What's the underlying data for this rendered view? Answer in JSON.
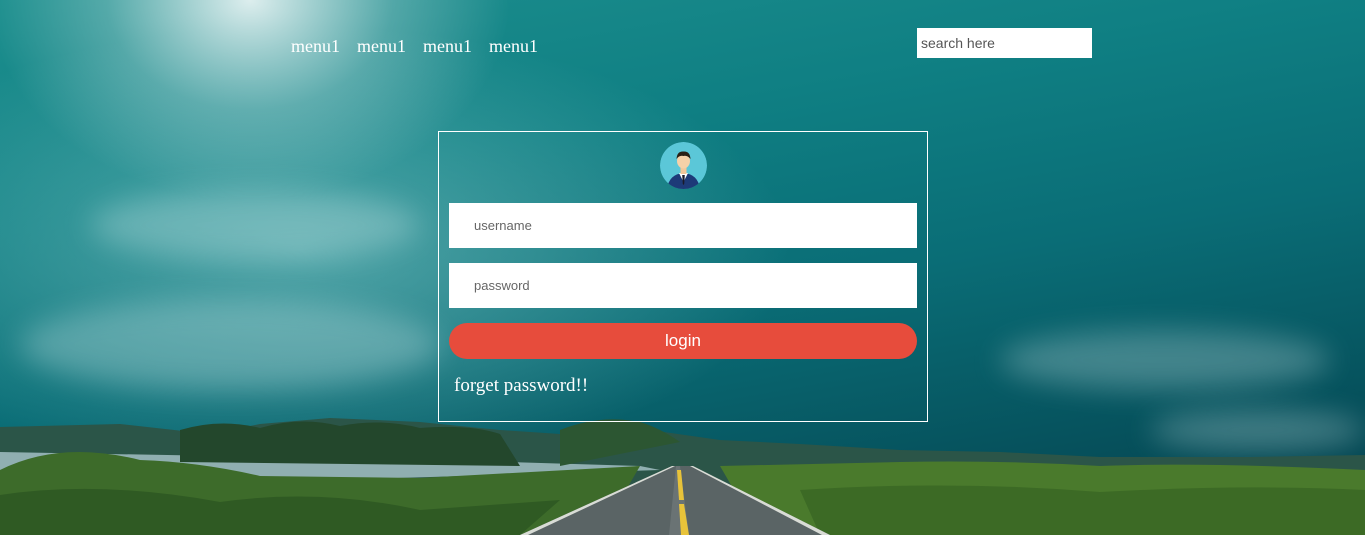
{
  "nav": {
    "items": [
      {
        "label": "menu1"
      },
      {
        "label": "menu1"
      },
      {
        "label": "menu1"
      },
      {
        "label": "menu1"
      }
    ]
  },
  "search": {
    "placeholder": "search here",
    "value": ""
  },
  "login_form": {
    "avatar_icon": "user-avatar-icon",
    "username_placeholder": "username",
    "password_placeholder": "password",
    "login_label": "login",
    "forget_label": "forget password!!"
  },
  "colors": {
    "accent_button": "#e74c3c",
    "sky_teal": "#0f7f83",
    "text": "#ffffff"
  }
}
